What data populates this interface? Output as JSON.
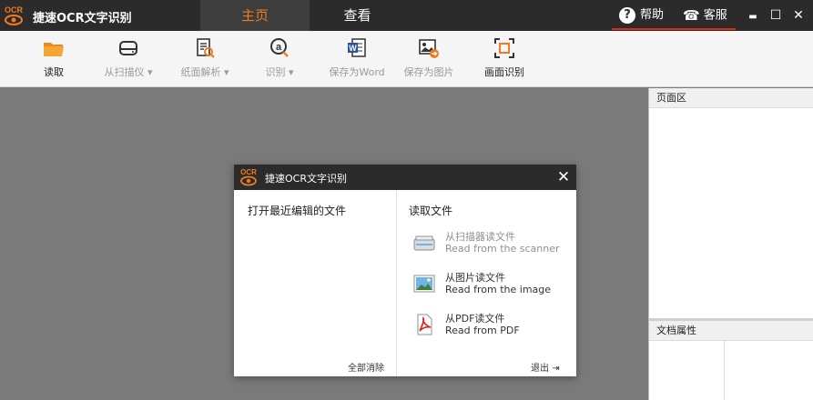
{
  "titlebar": {
    "logo_text": "OCR",
    "app_title": "捷速OCR文字识别",
    "tabs": [
      {
        "label": "主页",
        "active": true
      },
      {
        "label": "查看",
        "active": false
      }
    ],
    "help_label": "帮助",
    "service_label": "客服",
    "minimize_glyph": "▬",
    "maximize_glyph": "☐",
    "close_glyph": "✕"
  },
  "ribbon": {
    "items": [
      {
        "label": "读取",
        "icon": "folder-icon",
        "enabled": true
      },
      {
        "label": "从扫描仪",
        "icon": "scanner-icon",
        "enabled": false,
        "dropdown": true
      },
      {
        "label": "纸面解析",
        "icon": "page-analyze-icon",
        "enabled": false,
        "dropdown": true
      },
      {
        "label": "识别",
        "icon": "recognize-icon",
        "enabled": false,
        "dropdown": true
      },
      {
        "label": "保存为Word",
        "icon": "word-icon",
        "enabled": false
      },
      {
        "label": "保存为图片",
        "icon": "save-image-icon",
        "enabled": false
      },
      {
        "label": "画面识别",
        "icon": "screen-capture-icon",
        "enabled": true
      }
    ],
    "dropdown_glyph": "▾"
  },
  "right_panel": {
    "page_area_title": "页面区",
    "doc_props_title": "文档属性"
  },
  "dialog": {
    "logo_text": "OCR",
    "title": "捷速OCR文字识别",
    "close_glyph": "✕",
    "recent_title": "打开最近编辑的文件",
    "read_title": "读取文件",
    "options": [
      {
        "zh": "从扫描器读文件",
        "en": "Read from the scanner",
        "icon": "scanner-icon",
        "enabled": false
      },
      {
        "zh": "从图片读文件",
        "en": "Read from the image",
        "icon": "image-icon",
        "enabled": true
      },
      {
        "zh": "从PDF读文件",
        "en": "Read from PDF",
        "icon": "pdf-icon",
        "enabled": true
      }
    ],
    "clear_all": "全部消除",
    "exit_label": "退出",
    "exit_glyph": "⇥"
  },
  "colors": {
    "accent": "#f07a1e",
    "titlebar_bg": "#2b2b2b",
    "workspace_bg": "#7a7a7a",
    "underline_red": "#e0271e"
  }
}
